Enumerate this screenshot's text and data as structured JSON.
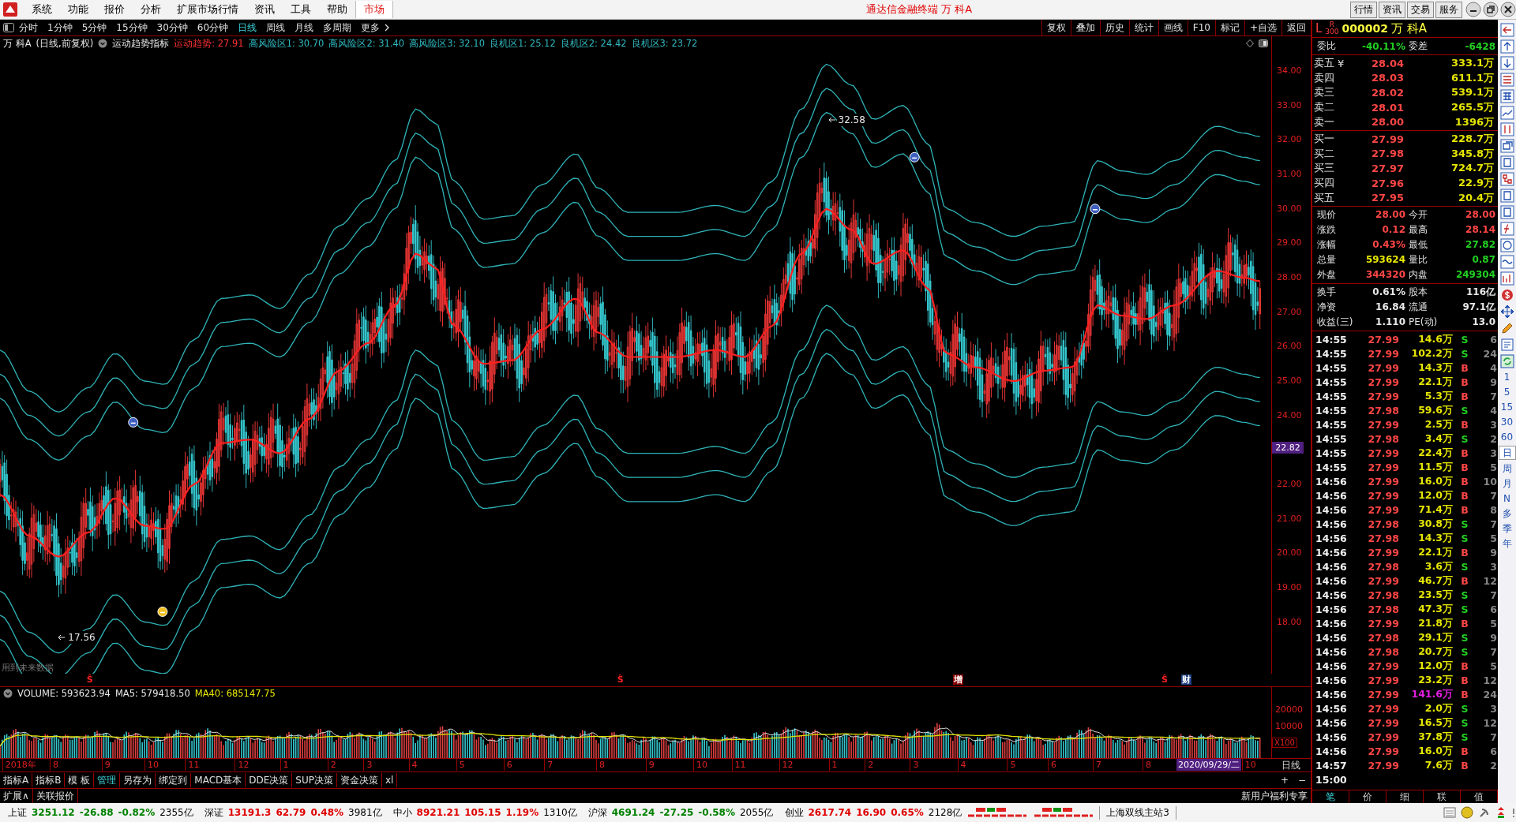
{
  "menu": [
    {
      "label": "系统",
      "selected": false
    },
    {
      "label": "功能",
      "selected": false
    },
    {
      "label": "报价",
      "selected": false
    },
    {
      "label": "分析",
      "selected": false
    },
    {
      "label": "扩展市场行情",
      "selected": false
    },
    {
      "label": "资讯",
      "selected": false
    },
    {
      "label": "工具",
      "selected": false
    },
    {
      "label": "帮助",
      "selected": false
    },
    {
      "label": "市场",
      "selected": true
    }
  ],
  "window": {
    "title": "通达信金融终端 万 科A"
  },
  "top_buttons": [
    "行情",
    "资讯",
    "交易",
    "服务"
  ],
  "periods": [
    {
      "label": "分时",
      "selected": false
    },
    {
      "label": "1分钟",
      "selected": false
    },
    {
      "label": "5分钟",
      "selected": false
    },
    {
      "label": "15分钟",
      "selected": false
    },
    {
      "label": "30分钟",
      "selected": false
    },
    {
      "label": "60分钟",
      "selected": false
    },
    {
      "label": "日线",
      "selected": true
    },
    {
      "label": "周线",
      "selected": false
    },
    {
      "label": "月线",
      "selected": false
    },
    {
      "label": "多周期",
      "selected": false
    },
    {
      "label": "更多",
      "selected": false
    }
  ],
  "chart_tools": [
    "复权",
    "叠加",
    "历史",
    "统计",
    "画线",
    "F10",
    "标记",
    "+自选",
    "返回"
  ],
  "indicator_header": {
    "stock": "万 科A",
    "mode": "(日线,前复权)",
    "indicator": "运动趋势指标",
    "values": [
      {
        "text": "运动趋势: 27.91",
        "color": "#ff3030"
      },
      {
        "text": "高风险区1: 30.70",
        "color": "#2fb8c0"
      },
      {
        "text": "高风险区2: 31.40",
        "color": "#2fb8c0"
      },
      {
        "text": "高风险区3: 32.10",
        "color": "#2fb8c0"
      },
      {
        "text": "良机区1: 25.12",
        "color": "#2fb8c0"
      },
      {
        "text": "良机区2: 24.42",
        "color": "#2fb8c0"
      },
      {
        "text": "良机区3: 23.72",
        "color": "#2fb8c0"
      }
    ]
  },
  "main_chart": {
    "note": "用到未来数据",
    "crosshair_price": "22.82",
    "price_axis": [
      "34.00",
      "33.00",
      "32.00",
      "31.00",
      "30.00",
      "29.00",
      "28.00",
      "27.00",
      "26.00",
      "25.00",
      "24.00",
      "22.00",
      "21.00",
      "20.00",
      "19.00",
      "18.00"
    ],
    "annotations": [
      "32.58",
      "17.56"
    ],
    "signals": [
      {
        "kind": "sell"
      },
      {
        "kind": "buy"
      },
      {
        "kind": "sell"
      },
      {
        "kind": "sell"
      }
    ]
  },
  "markers": [
    {
      "label": "Ŝ",
      "kind": "plain"
    },
    {
      "label": "Ŝ",
      "kind": "plain"
    },
    {
      "label": "增",
      "kind": "event-red"
    },
    {
      "label": "Ŝ",
      "kind": "plain"
    },
    {
      "label": "财",
      "kind": "event-blue"
    }
  ],
  "volume": {
    "header": [
      {
        "text": "VOLUME: 593623.94",
        "color": "#e8e8e8"
      },
      {
        "text": "MA5: 579418.50",
        "color": "#e8e8e8"
      },
      {
        "text": "MA40: 685147.75",
        "color": "#e6e600"
      }
    ],
    "axis": [
      "20000",
      "10000"
    ],
    "unit": "X100"
  },
  "date_axis": [
    "2018年",
    "8",
    "9",
    "10",
    "11",
    "12",
    "1",
    "2",
    "3",
    "4",
    "5",
    "6",
    "7",
    "8",
    "9",
    "10",
    "11",
    "12",
    "1",
    "2",
    "3",
    "4",
    "5",
    "6",
    "7",
    "8",
    "10"
  ],
  "date_box": "2020/09/29/二",
  "period_label": "日线",
  "zoom_buttons": [
    "+",
    "−"
  ],
  "bottom_tabs": [
    {
      "label": "指标A",
      "selected": false
    },
    {
      "label": "指标B",
      "selected": false
    },
    {
      "label": "模 板",
      "selected": false
    },
    {
      "label": "管理",
      "selected": true
    },
    {
      "label": "另存为",
      "selected": false
    },
    {
      "label": "绑定到",
      "selected": false
    },
    {
      "label": "MACD基本",
      "selected": false
    },
    {
      "label": "DDE决策",
      "selected": false
    },
    {
      "label": "SUP决策",
      "selected": false
    },
    {
      "label": "资金决策",
      "selected": false
    },
    {
      "label": "xl",
      "selected": false
    }
  ],
  "bottom_tabs2": [
    "扩展∧",
    "关联报价"
  ],
  "promo": "新用户福利专享",
  "quote": {
    "prefix": "L",
    "index_tag": "R",
    "index_num": "300",
    "code": "000002",
    "name": "万 科A",
    "ratio": {
      "label": "委比",
      "value": "-40.11%",
      "label2": "委差",
      "value2": "-6428"
    },
    "asks": [
      {
        "label": "卖五",
        "mark": "¥",
        "price": "28.04",
        "volume": "333.1万"
      },
      {
        "label": "卖四",
        "price": "28.03",
        "volume": "611.1万"
      },
      {
        "label": "卖三",
        "price": "28.02",
        "volume": "539.1万"
      },
      {
        "label": "卖二",
        "price": "28.01",
        "volume": "265.5万"
      },
      {
        "label": "卖一",
        "price": "28.00",
        "volume": "1396万"
      }
    ],
    "bids": [
      {
        "label": "买一",
        "price": "27.99",
        "volume": "228.7万"
      },
      {
        "label": "买二",
        "price": "27.98",
        "volume": "345.8万"
      },
      {
        "label": "买三",
        "price": "27.97",
        "volume": "724.7万"
      },
      {
        "label": "买四",
        "price": "27.96",
        "volume": "22.9万"
      },
      {
        "label": "买五",
        "price": "27.95",
        "volume": "20.4万"
      }
    ],
    "stats": [
      {
        "cells": [
          {
            "label": "现价",
            "value": "28.00",
            "color": "#ff4646"
          },
          {
            "label": "今开",
            "value": "28.00",
            "color": "#ff4646"
          }
        ]
      },
      {
        "cells": [
          {
            "label": "涨跌",
            "value": "0.12",
            "color": "#ff4646"
          },
          {
            "label": "最高",
            "value": "28.14",
            "color": "#ff4646"
          }
        ]
      },
      {
        "cells": [
          {
            "label": "涨幅",
            "value": "0.43%",
            "color": "#ff4646"
          },
          {
            "label": "最低",
            "value": "27.82",
            "color": "#22d022"
          }
        ]
      },
      {
        "cells": [
          {
            "label": "总量",
            "value": "593624",
            "color": "#e6e600"
          },
          {
            "label": "量比",
            "value": "0.87",
            "color": "#22d022"
          }
        ]
      },
      {
        "cells": [
          {
            "label": "外盘",
            "value": "344320",
            "color": "#ff4646"
          },
          {
            "label": "内盘",
            "value": "249304",
            "color": "#22d022"
          }
        ]
      }
    ],
    "extra": [
      {
        "cells": [
          {
            "label": "换手",
            "value": "0.61%",
            "color": "#e8e8e8"
          },
          {
            "label": "股本",
            "value": "116亿",
            "color": "#e8e8e8"
          }
        ]
      },
      {
        "cells": [
          {
            "label": "净资",
            "value": "16.84",
            "color": "#e8e8e8"
          },
          {
            "label": "流通",
            "value": "97.1亿",
            "color": "#e8e8e8"
          }
        ]
      },
      {
        "cells": [
          {
            "label": "收益(三)",
            "value": "1.110",
            "color": "#e8e8e8"
          },
          {
            "label": "PE(动)",
            "value": "13.0",
            "color": "#e8e8e8"
          }
        ]
      }
    ]
  },
  "ticks": [
    {
      "time": "14:55",
      "price": "27.99",
      "volume": "14.6万",
      "side": "S",
      "count": "6",
      "big": false
    },
    {
      "time": "14:55",
      "price": "27.99",
      "volume": "102.2万",
      "side": "S",
      "count": "24",
      "big": false
    },
    {
      "time": "14:55",
      "price": "27.99",
      "volume": "14.3万",
      "side": "B",
      "count": "4",
      "big": false
    },
    {
      "time": "14:55",
      "price": "27.99",
      "volume": "22.1万",
      "side": "B",
      "count": "9",
      "big": false
    },
    {
      "time": "14:55",
      "price": "27.99",
      "volume": "5.3万",
      "side": "B",
      "count": "7",
      "big": false
    },
    {
      "time": "14:55",
      "price": "27.98",
      "volume": "59.6万",
      "side": "S",
      "count": "4",
      "big": false
    },
    {
      "time": "14:55",
      "price": "27.99",
      "volume": "2.5万",
      "side": "B",
      "count": "3",
      "big": false
    },
    {
      "time": "14:55",
      "price": "27.98",
      "volume": "3.4万",
      "side": "S",
      "count": "2",
      "big": false
    },
    {
      "time": "14:55",
      "price": "27.99",
      "volume": "22.4万",
      "side": "B",
      "count": "3",
      "big": false
    },
    {
      "time": "14:55",
      "price": "27.99",
      "volume": "11.5万",
      "side": "B",
      "count": "5",
      "big": false
    },
    {
      "time": "14:56",
      "price": "27.99",
      "volume": "16.0万",
      "side": "B",
      "count": "10",
      "big": false
    },
    {
      "time": "14:56",
      "price": "27.99",
      "volume": "12.0万",
      "side": "B",
      "count": "7",
      "big": false
    },
    {
      "time": "14:56",
      "price": "27.99",
      "volume": "71.4万",
      "side": "B",
      "count": "8",
      "big": false
    },
    {
      "time": "14:56",
      "price": "27.98",
      "volume": "30.8万",
      "side": "S",
      "count": "7",
      "big": false
    },
    {
      "time": "14:56",
      "price": "27.98",
      "volume": "14.3万",
      "side": "S",
      "count": "5",
      "big": false
    },
    {
      "time": "14:56",
      "price": "27.99",
      "volume": "22.1万",
      "side": "B",
      "count": "9",
      "big": false
    },
    {
      "time": "14:56",
      "price": "27.98",
      "volume": "3.6万",
      "side": "S",
      "count": "3",
      "big": false
    },
    {
      "time": "14:56",
      "price": "27.99",
      "volume": "46.7万",
      "side": "B",
      "count": "12",
      "big": false
    },
    {
      "time": "14:56",
      "price": "27.98",
      "volume": "23.5万",
      "side": "S",
      "count": "7",
      "big": false
    },
    {
      "time": "14:56",
      "price": "27.98",
      "volume": "47.3万",
      "side": "S",
      "count": "6",
      "big": false
    },
    {
      "time": "14:56",
      "price": "27.99",
      "volume": "21.8万",
      "side": "B",
      "count": "5",
      "big": false
    },
    {
      "time": "14:56",
      "price": "27.98",
      "volume": "29.1万",
      "side": "S",
      "count": "9",
      "big": false
    },
    {
      "time": "14:56",
      "price": "27.98",
      "volume": "20.7万",
      "side": "S",
      "count": "7",
      "big": false
    },
    {
      "time": "14:56",
      "price": "27.99",
      "volume": "12.0万",
      "side": "B",
      "count": "5",
      "big": false
    },
    {
      "time": "14:56",
      "price": "27.99",
      "volume": "23.2万",
      "side": "B",
      "count": "12",
      "big": false
    },
    {
      "time": "14:56",
      "price": "27.99",
      "volume": "141.6万",
      "side": "B",
      "count": "24",
      "big": true
    },
    {
      "time": "14:56",
      "price": "27.99",
      "volume": "2.0万",
      "side": "S",
      "count": "3",
      "big": false
    },
    {
      "time": "14:56",
      "price": "27.99",
      "volume": "16.5万",
      "side": "S",
      "count": "12",
      "big": false
    },
    {
      "time": "14:56",
      "price": "27.99",
      "volume": "37.8万",
      "side": "S",
      "count": "7",
      "big": false
    },
    {
      "time": "14:56",
      "price": "27.99",
      "volume": "16.0万",
      "side": "B",
      "count": "6",
      "big": false
    },
    {
      "time": "14:57",
      "price": "27.99",
      "volume": "7.6万",
      "side": "B",
      "count": "2",
      "big": false
    },
    {
      "time": "15:00"
    }
  ],
  "tick_tabs": [
    {
      "label": "笔",
      "selected": true
    },
    {
      "label": "价",
      "selected": false
    },
    {
      "label": "细",
      "selected": false
    },
    {
      "label": "联",
      "selected": false
    },
    {
      "label": "值",
      "selected": false
    }
  ],
  "sidebar_periods": [
    {
      "label": "1",
      "selected": false
    },
    {
      "label": "5",
      "selected": false
    },
    {
      "label": "15",
      "selected": false
    },
    {
      "label": "30",
      "selected": false
    },
    {
      "label": "60",
      "selected": false
    },
    {
      "label": "日",
      "selected": true
    },
    {
      "label": "周",
      "selected": false
    },
    {
      "label": "月",
      "selected": false
    },
    {
      "label": "N",
      "selected": false
    },
    {
      "label": "多",
      "selected": false
    },
    {
      "label": "季",
      "selected": false
    },
    {
      "label": "年",
      "selected": false
    }
  ],
  "status": {
    "indices": [
      {
        "name": "上证",
        "value": "3251.12",
        "change": "-26.88",
        "pct": "-0.82%",
        "amount": "2355亿",
        "color": "#008000"
      },
      {
        "name": "深证",
        "value": "13191.3",
        "change": "62.79",
        "pct": "0.48%",
        "amount": "3981亿",
        "color": "#e00000"
      },
      {
        "name": "中小",
        "value": "8921.21",
        "change": "105.15",
        "pct": "1.19%",
        "amount": "1310亿",
        "color": "#e00000"
      },
      {
        "name": "沪深",
        "value": "4691.24",
        "change": "-27.25",
        "pct": "-0.58%",
        "amount": "2055亿",
        "color": "#008000"
      },
      {
        "name": "创业",
        "value": "2617.74",
        "change": "16.90",
        "pct": "0.65%",
        "amount": "2128亿",
        "color": "#e00000"
      }
    ],
    "server": "上海双线主站3"
  }
}
